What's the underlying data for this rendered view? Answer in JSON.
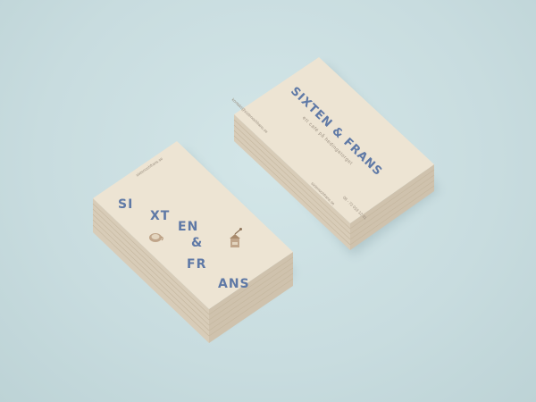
{
  "colors": {
    "background": "#c9dde0",
    "card": "#ede4d3",
    "card_edge": "#d8ccb8",
    "ink_blue": "#5f79a6",
    "ink_grey": "#9a8f80",
    "illustration": "#b79a7c"
  },
  "back_card": {
    "title": "SIXTEN & FRANS",
    "tagline": "ett café på hedingatorget",
    "email": "kontakt@sixtenochfrans.se",
    "website": "sixtenochfrans.se",
    "phone": "08 - 72 019 12 81"
  },
  "front_card": {
    "website": "sixtenochfrans.se",
    "letters": {
      "row1_left": "SI",
      "row1_right": "XT",
      "row2": "EN",
      "row3": "&",
      "row4_left": "FR",
      "row4_right": "ANS"
    },
    "icons": [
      "coffee-cup-icon",
      "coffee-grinder-icon"
    ]
  }
}
